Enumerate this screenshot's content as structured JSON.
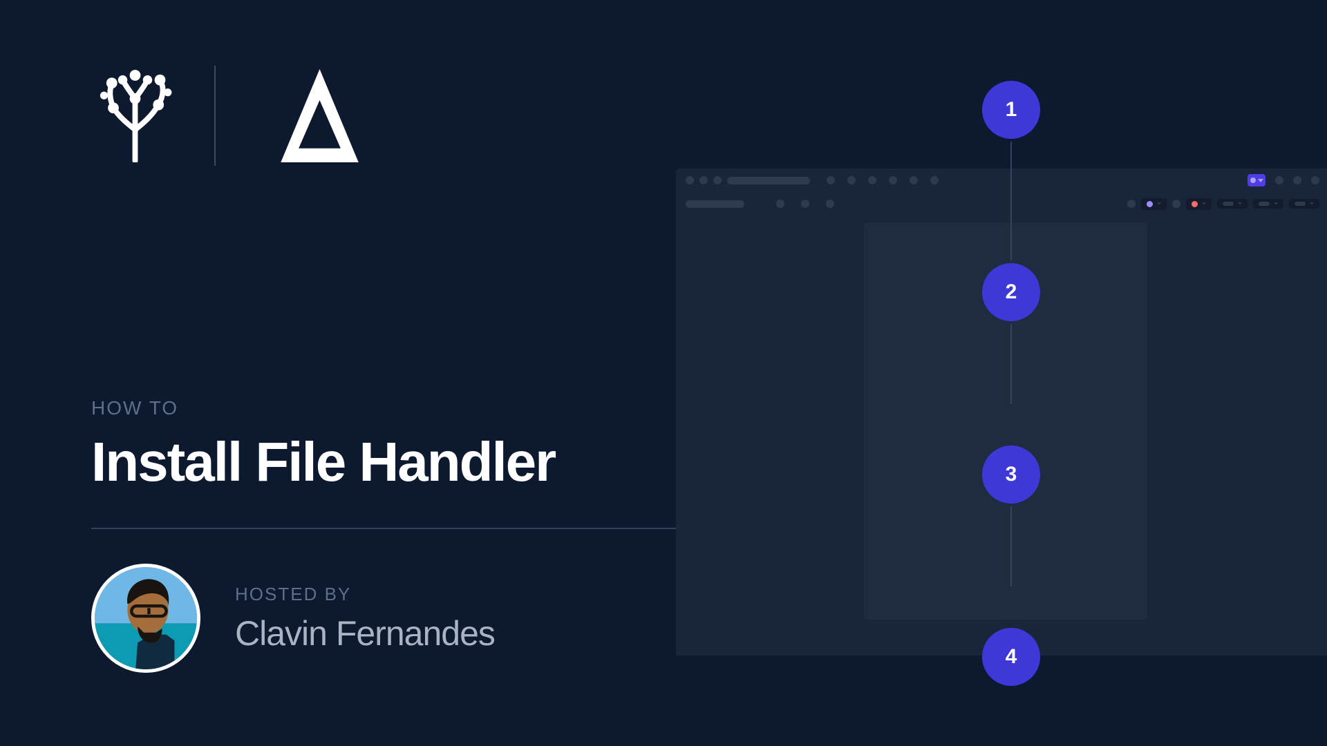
{
  "kicker": "HOW TO",
  "title": "Install File Handler",
  "host_label": "HOSTED BY",
  "host_name": "Clavin Fernandes",
  "steps": [
    "1",
    "2",
    "3",
    "4"
  ],
  "colors": {
    "bg": "#0c192e",
    "accent": "#3f38d8",
    "muted": "#5d6f89"
  },
  "icons": {
    "left_logo": "tree-network-icon",
    "right_logo": "delta-icon"
  }
}
